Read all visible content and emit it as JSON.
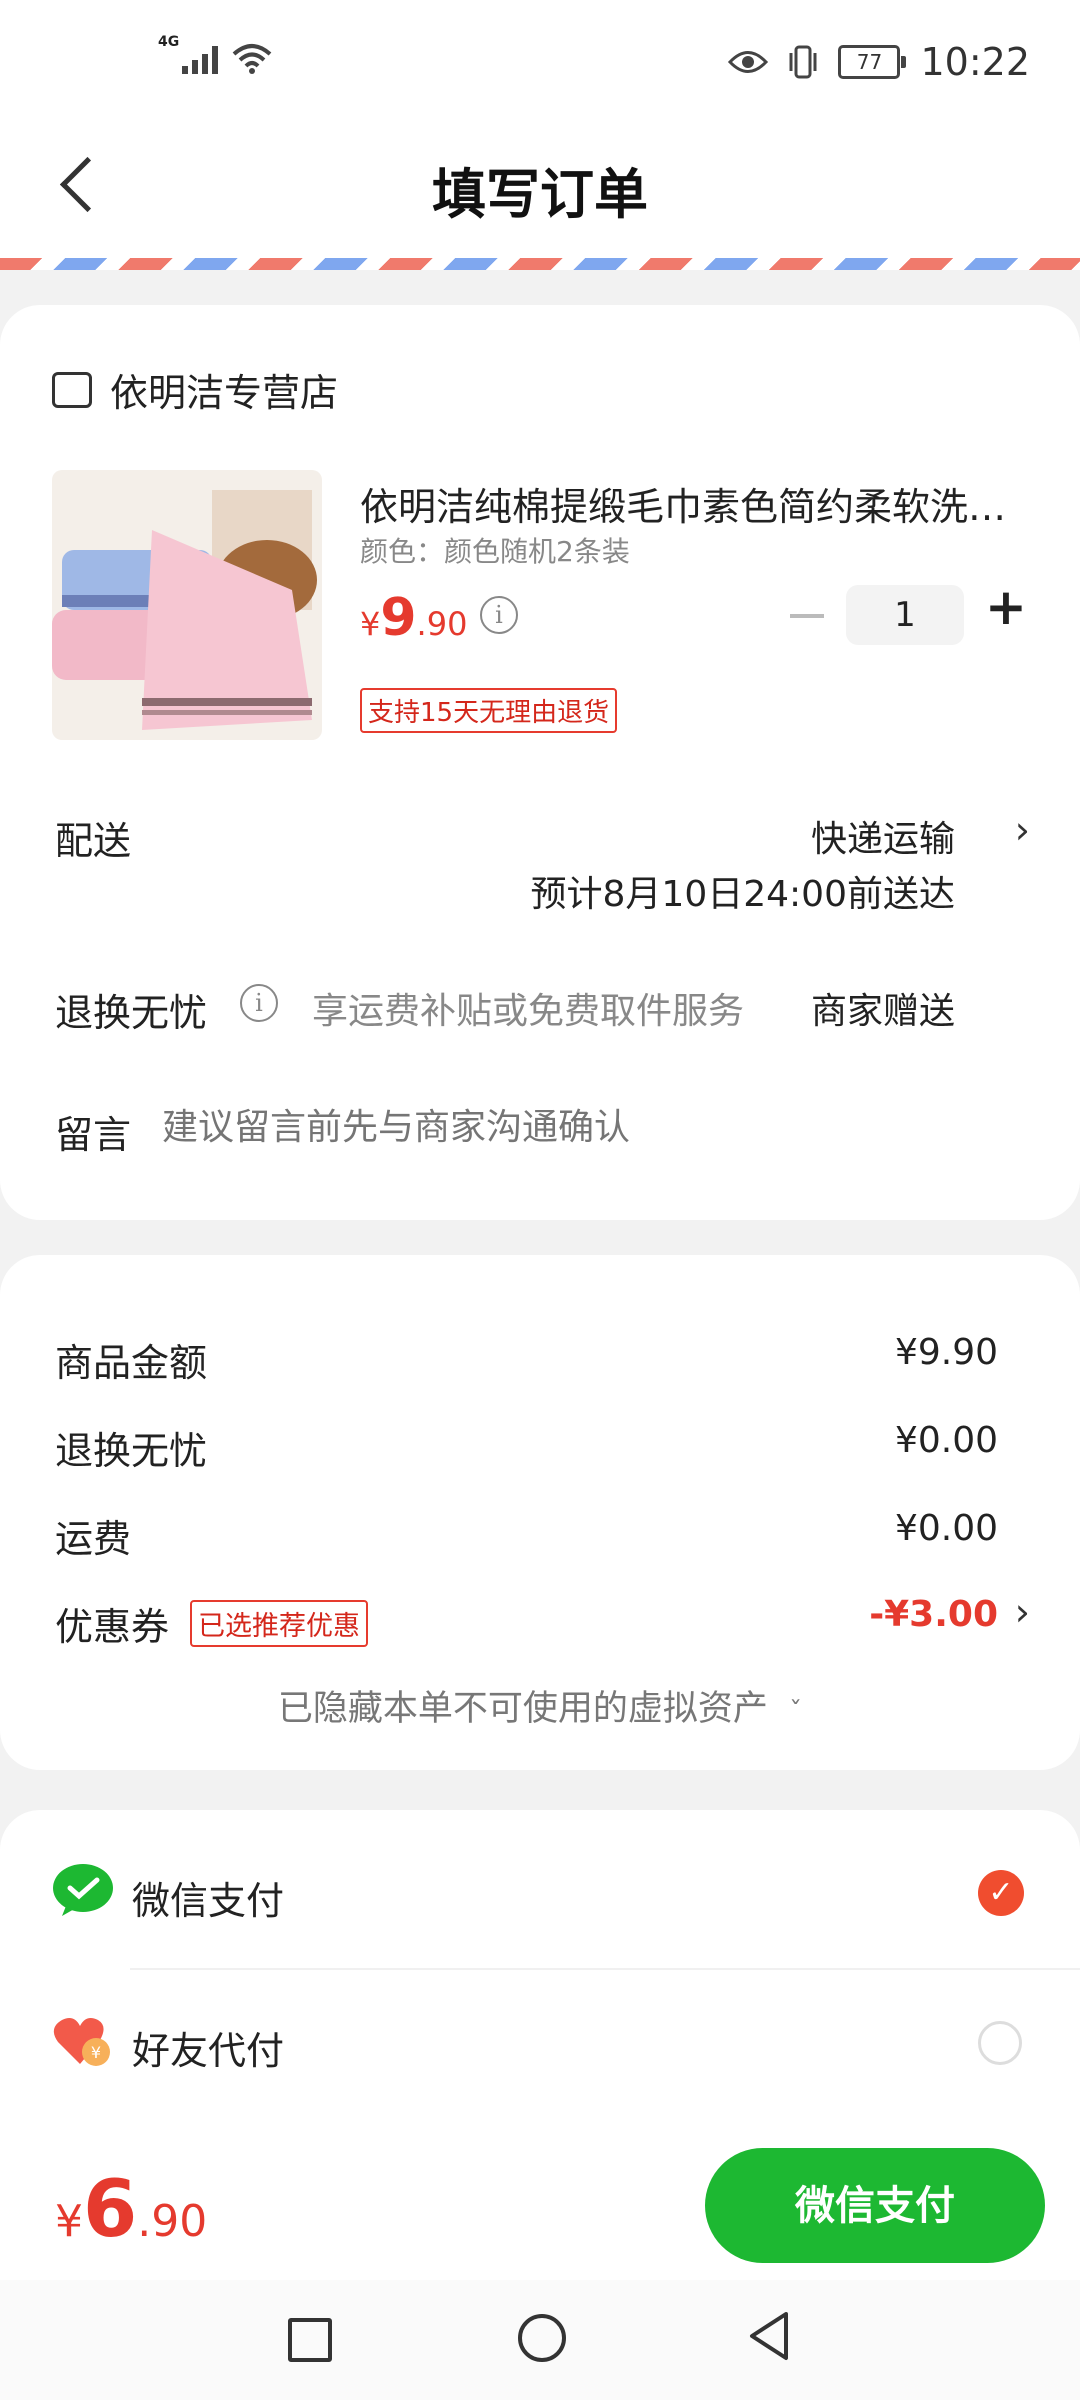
{
  "status_bar": {
    "network": "4G",
    "battery": "77",
    "time": "10:22"
  },
  "header": {
    "title": "填写订单"
  },
  "store": {
    "name": "依明洁专营店"
  },
  "product": {
    "title": "依明洁纯棉提缎毛巾素色简约柔软洗…",
    "spec": "颜色：颜色随机2条装",
    "price_symbol": "¥",
    "price_int": "9",
    "price_dec": ".90",
    "quantity": "1",
    "tag": "支持15天无理由退货"
  },
  "delivery": {
    "label": "配送",
    "method": "快递运输",
    "eta": "预计8月10日24:00前送达"
  },
  "return": {
    "label": "退换无忧",
    "desc": "享运费补贴或免费取件服务",
    "value": "商家赠送"
  },
  "message": {
    "label": "留言",
    "placeholder": "建议留言前先与商家沟通确认"
  },
  "summary": {
    "rows": [
      {
        "label": "商品金额",
        "value": "¥9.90"
      },
      {
        "label": "退换无忧",
        "value": "¥0.00"
      },
      {
        "label": "运费",
        "value": "¥0.00"
      }
    ],
    "coupon": {
      "label": "优惠券",
      "tag": "已选推荐优惠",
      "value": "-¥3.00"
    },
    "hidden_note": "已隐藏本单不可使用的虚拟资产"
  },
  "payment": {
    "options": [
      {
        "label": "微信支付",
        "selected": true
      },
      {
        "label": "好友代付",
        "selected": false
      }
    ]
  },
  "total": {
    "symbol": "¥",
    "int": "6",
    "dec": ".90"
  },
  "pay_button": "微信支付",
  "colors": {
    "accent_red": "#e53a2e",
    "wechat_green": "#1db832"
  }
}
